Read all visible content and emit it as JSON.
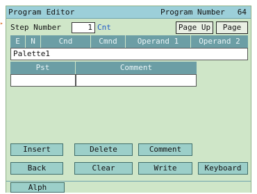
{
  "titlebar": {
    "title": "Program Editor",
    "number_label": "Program Number",
    "number_value": "64"
  },
  "steprow": {
    "label": "Step Number",
    "step_value": "1",
    "cnt_label": "Cnt",
    "page_up": "Page Up",
    "page_dn": "Page Dn"
  },
  "grid": {
    "headers": [
      "E",
      "N",
      "Cnd",
      "Cmnd",
      "Operand 1",
      "Operand 2"
    ],
    "palette_text": "Palette1",
    "sub_headers": [
      "Pst",
      "Comment"
    ]
  },
  "buttons": {
    "insert": "Insert",
    "delete": "Delete",
    "comment": "Comment",
    "back": "Back",
    "clear": "Clear",
    "write": "Write",
    "keyboard": "Keyboard"
  },
  "bottom": {
    "alph": "Alph"
  }
}
